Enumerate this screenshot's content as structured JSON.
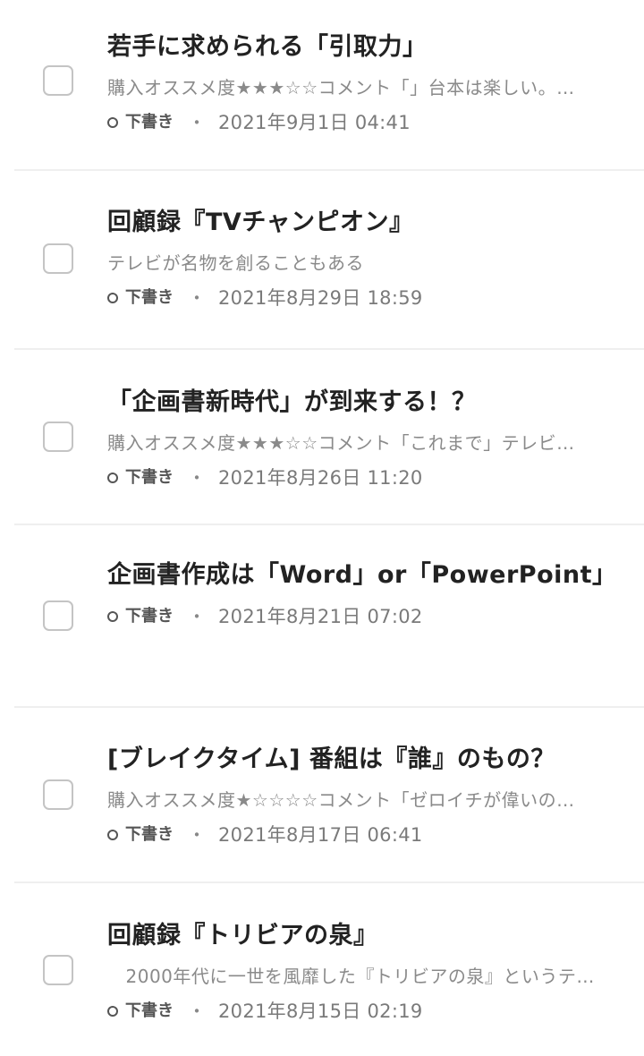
{
  "posts": [
    {
      "title": "若手に求められる「引取力」",
      "excerpt": "購入オススメ度★★★☆☆コメント「」台本は楽しい。…",
      "status": "下書き",
      "separator": "・",
      "date": "2021年9月1日 04:41"
    },
    {
      "title": "回顧録『TVチャンピオン』",
      "excerpt": "テレビが名物を創ることもある",
      "status": "下書き",
      "separator": "・",
      "date": "2021年8月29日 18:59"
    },
    {
      "title": "「企画書新時代」が到来する！？",
      "excerpt": "購入オススメ度★★★☆☆コメント「これまで」テレビ…",
      "status": "下書き",
      "separator": "・",
      "date": "2021年8月26日 11:20"
    },
    {
      "title": "企画書作成は「Word」or「PowerPoint」",
      "excerpt": "",
      "status": "下書き",
      "separator": "・",
      "date": "2021年8月21日 07:02"
    },
    {
      "title": "[ブレイクタイム] 番組は『誰』のもの？",
      "excerpt": "購入オススメ度★☆☆☆☆コメント「ゼロイチが偉いの…",
      "status": "下書き",
      "separator": "・",
      "date": "2021年8月17日 06:41"
    },
    {
      "title": "回顧録『トリビアの泉』",
      "excerpt": "　2000年代に一世を風靡した『トリビアの泉』というテ…",
      "status": "下書き",
      "separator": "・",
      "date": "2021年8月15日 02:19"
    }
  ]
}
